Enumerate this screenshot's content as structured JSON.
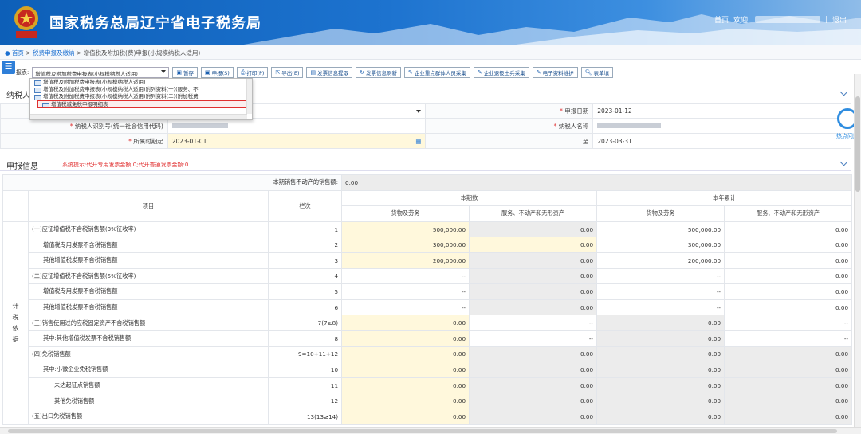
{
  "header": {
    "title": "国家税务总局辽宁省电子税务局",
    "home": "首页",
    "welcome": "欢迎,",
    "logout": "退出"
  },
  "breadcrumb": {
    "home": "首页",
    "l1": "税费申报及缴纳",
    "l2": "增值税及附加税(费)申报(小规模纳税人适用)"
  },
  "toolbar": {
    "form_label": "报表:",
    "selected": "增值税及附加税费申报表(小规模纳税人适用)",
    "buttons": [
      "暂存",
      "申报(S)",
      "打印(P)",
      "导出(E)",
      "发票信息提取",
      "发票信息刷新",
      "企业重点群体人员采集",
      "企业退役士兵采集",
      "电子资料维护",
      "表单填"
    ]
  },
  "dropdown": [
    "增值税及附加税费申报表(小规模纳税人适用)",
    "增值税及附加税费申报表(小规模纳税人适用)附列资料(一)(服务、不",
    "增值税及附加税费申报表(小规模纳税人适用)附列资料(二)(附加税费",
    "增值税减免税申报明细表"
  ],
  "sections": {
    "taxpayer": "纳税人",
    "report": "申报信息"
  },
  "form": {
    "report_date_label": "申报日期",
    "report_date": "2023-01-12",
    "taxid_label": "纳税人识别号(统一社会信用代码)",
    "name_label": "纳税人名称",
    "period_label": "所属时期起",
    "period_start": "2023-01-01",
    "period_to_label": "至",
    "period_end": "2023-03-31"
  },
  "tip": "系统提示:代开专用发票金额:0;代开普通发票金额:0",
  "realestate": {
    "label": "本期销售不动产的销售额:",
    "value": "0.00"
  },
  "thead": {
    "item": "项目",
    "col": "栏次",
    "current": "本期数",
    "ytd": "本年累计",
    "goods": "货物及劳务",
    "services": "服务、不动产和无形资产"
  },
  "side": [
    "计",
    "税",
    "依",
    "据"
  ],
  "rows": [
    {
      "name": "(一)应征增值税不含税销售额(3%征收率)",
      "col": "1",
      "v": [
        "500,000.00",
        "0.00",
        "500,000.00",
        "0.00"
      ]
    },
    {
      "name": "增值税专用发票不含税销售额",
      "col": "2",
      "v": [
        "300,000.00",
        "0.00",
        "300,000.00",
        "0.00"
      ]
    },
    {
      "name": "其他增值税发票不含税销售额",
      "col": "3",
      "v": [
        "200,000.00",
        "0.00",
        "200,000.00",
        "0.00"
      ]
    },
    {
      "name": "(二)应征增值税不含税销售额(5%征收率)",
      "col": "4",
      "v": [
        "--",
        "0.00",
        "--",
        "0.00"
      ]
    },
    {
      "name": "增值税专用发票不含税销售额",
      "col": "5",
      "v": [
        "--",
        "0.00",
        "--",
        "0.00"
      ]
    },
    {
      "name": "其他增值税发票不含税销售额",
      "col": "6",
      "v": [
        "--",
        "0.00",
        "--",
        "0.00"
      ]
    },
    {
      "name": "(三)销售使用过的应税固定资产不含税销售额",
      "col": "7(7≥8)",
      "v": [
        "0.00",
        "--",
        "0.00",
        "--"
      ]
    },
    {
      "name": "其中:其他增值税发票不含税销售额",
      "col": "8",
      "v": [
        "0.00",
        "--",
        "0.00",
        "--"
      ]
    },
    {
      "name": "(四)免税销售额",
      "col": "9=10+11+12",
      "v": [
        "0.00",
        "0.00",
        "0.00",
        "0.00"
      ]
    },
    {
      "name": "其中:小微企业免税销售额",
      "col": "10",
      "v": [
        "0.00",
        "0.00",
        "0.00",
        "0.00"
      ]
    },
    {
      "name": "未达起征点销售额",
      "col": "11",
      "v": [
        "0.00",
        "0.00",
        "0.00",
        "0.00"
      ]
    },
    {
      "name": "其他免税销售额",
      "col": "12",
      "v": [
        "0.00",
        "0.00",
        "0.00",
        "0.00"
      ]
    },
    {
      "name": "(五)出口免税销售额",
      "col": "13(13≥14)",
      "v": [
        "0.00",
        "0.00",
        "0.00",
        "0.00"
      ]
    }
  ],
  "hot_label": "热点问题"
}
